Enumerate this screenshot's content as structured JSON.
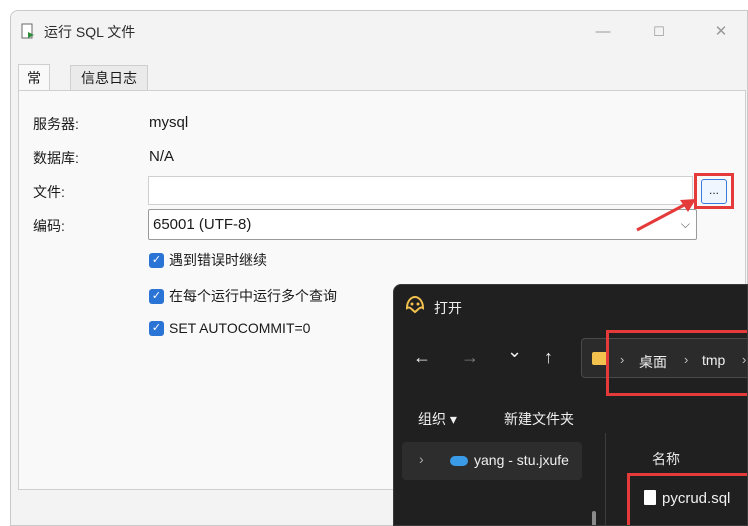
{
  "window": {
    "title": "运行 SQL 文件",
    "minimize_icon": "minimize-icon",
    "maximize_icon": "maximize-icon",
    "close_icon": "close-icon"
  },
  "tabs": [
    {
      "label": "常规",
      "active": true
    },
    {
      "label": "信息日志",
      "active": false
    }
  ],
  "form": {
    "server_label": "服务器:",
    "server_value": "mysql",
    "database_label": "数据库:",
    "database_value": "N/A",
    "file_label": "文件:",
    "file_value": "",
    "browse_label": "...",
    "encoding_label": "编码:",
    "encoding_value": "65001 (UTF-8)"
  },
  "options": [
    {
      "label": "遇到错误时继续",
      "checked": true
    },
    {
      "label": "在每个运行中运行多个查询",
      "checked": true
    },
    {
      "label": "SET AUTOCOMMIT=0",
      "checked": true
    }
  ],
  "open_dialog": {
    "title": "打开",
    "nav": {
      "back": "←",
      "forward": "→",
      "recent": "⌄",
      "up": "↑"
    },
    "breadcrumb": [
      "桌面",
      "tmp"
    ],
    "toolbar": {
      "organize": "组织 ▾",
      "new_folder": "新建文件夹"
    },
    "sidebar": [
      {
        "label": "yang - stu.jxufe",
        "icon": "onedrive-icon"
      }
    ],
    "column_header": "名称",
    "files": [
      {
        "name": "pycrud.sql",
        "icon": "file-icon"
      }
    ]
  },
  "colors": {
    "highlight": "#e53a3a",
    "checkbox": "#2a74d6",
    "dialog_bg": "#202020"
  }
}
